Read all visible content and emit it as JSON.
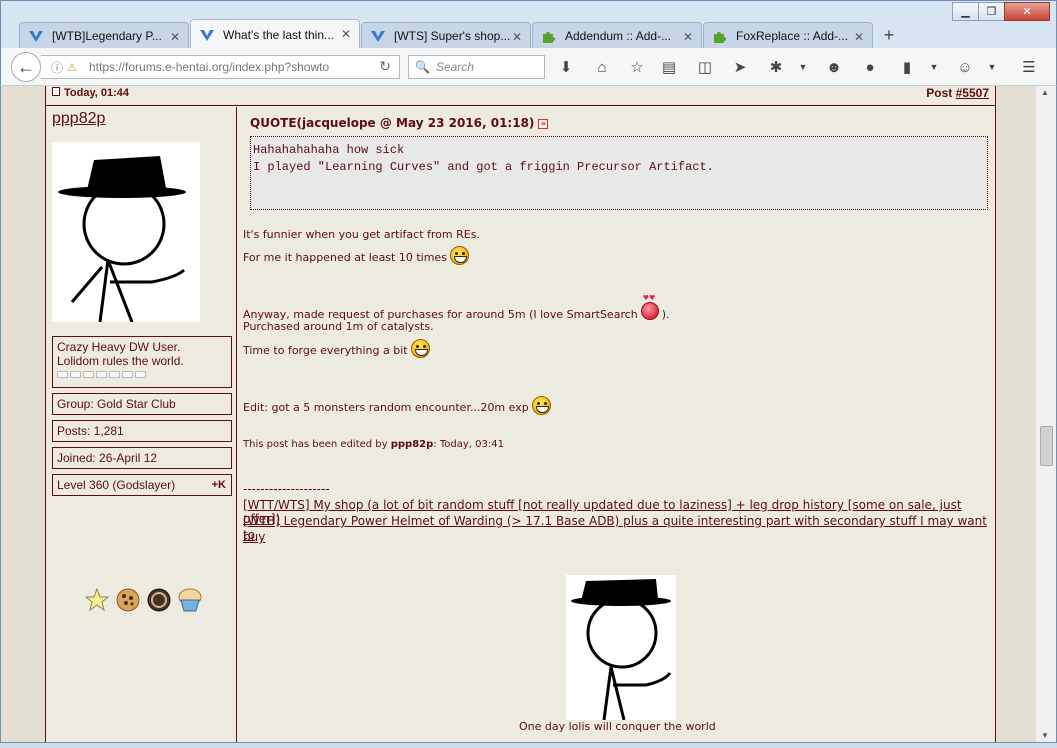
{
  "tabs": [
    {
      "title": "[WTB]Legendary P...",
      "icon": "forum-icon",
      "active": false
    },
    {
      "title": "What's the last thin...",
      "icon": "forum-icon",
      "active": true
    },
    {
      "title": "[WTS] Super's shop...",
      "icon": "forum-icon",
      "active": false
    },
    {
      "title": "Addendum :: Add-...",
      "icon": "puzzle-icon",
      "active": false
    },
    {
      "title": "FoxReplace :: Add-...",
      "icon": "puzzle-icon",
      "active": false
    }
  ],
  "navbar": {
    "url": "https://forums.e-hentai.org/index.php?showto",
    "search_placeholder": "Search"
  },
  "post": {
    "date": "Today, 01:44",
    "post_label": "Post ",
    "post_number": "#5507",
    "author": {
      "username": "ppp82p",
      "title_line1": "Crazy Heavy DW User.",
      "title_line2": "Lolidom rules the world.",
      "group": "Group: Gold Star Club",
      "posts": "Posts: 1,281",
      "joined": "Joined: 26-April 12",
      "level": "Level 360 (Godslayer)",
      "plus_k": "+K"
    },
    "quote": {
      "title": "QUOTE(jacquelope @ May 23 2016, 01:18)",
      "icon_glyph": "»",
      "line1": "Hahahahahaha how sick",
      "line2": "I played \"Learning Curves\" and got a friggin Precursor Artifact."
    },
    "body": {
      "l1": "It's funnier when you get artifact from REs.",
      "l2": "For me it happened at least 10 times",
      "l3a": "Anyway, made request of purchases for around 5m (I love SmartSearch",
      "l3b": ").",
      "l4": "Purchased around 1m of catalysts.",
      "l5": "Time to forge everything a bit",
      "l6": "Edit: got a 5 monsters random encounter...20m exp",
      "edit_prefix": "This post has been edited by ",
      "edit_user": "ppp82p",
      "edit_suffix": ": Today, 03:41"
    },
    "signature": {
      "separator": "--------------------",
      "link1": "[WTT/WTS] My shop (a lot of bit random stuff [not really updated due to laziness] + leg drop history [some on sale, just offer])",
      "link2a": "[WTB] Legendary Power Helmet of Warding (> 17.1 Base ADB) plus a quite interesting part with secondary stuff I may want to",
      "link2b": "buy",
      "caption": "One day lolis will conquer the world"
    }
  }
}
